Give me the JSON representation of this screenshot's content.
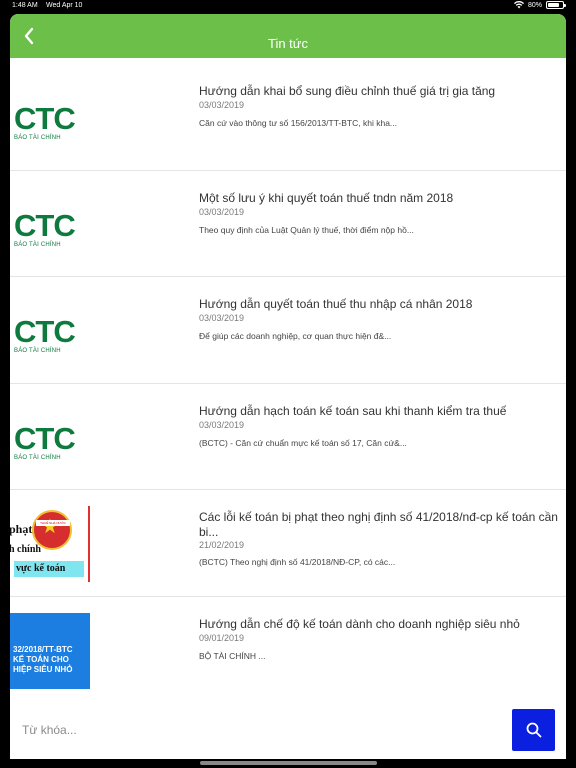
{
  "status_bar": {
    "time": "1:48 AM",
    "date": "Wed Apr 10",
    "battery": "80%",
    "battery_level": 0.8
  },
  "header": {
    "title": "Tin tức"
  },
  "articles": [
    {
      "title": "Hướng dẫn khai bổ sung điều chỉnh thuế giá trị gia tăng",
      "date": "03/03/2019",
      "excerpt": "Căn cứ vào thông tư số 156/2013/TT-BTC, khi kha...",
      "thumb_text": "CTC",
      "thumb_sub": "BÁO TÀI CHÍNH"
    },
    {
      "title": "Một số lưu ý khi quyết toán thuế tndn năm 2018",
      "date": "03/03/2019",
      "excerpt": "Theo quy định của Luật Quản lý thuế, thời điểm nộp hồ...",
      "thumb_text": "CTC",
      "thumb_sub": "BÁO TÀI CHÍNH"
    },
    {
      "title": "Hướng dẫn quyết toán thuế thu nhập cá nhân 2018",
      "date": "03/03/2019",
      "excerpt": "Để giúp các doanh nghiệp, cơ quan thực hiện đ&...",
      "thumb_text": "CTC",
      "thumb_sub": "BÁO TÀI CHÍNH"
    },
    {
      "title": "Hướng dẫn hạch toán kế toán sau khi thanh kiểm tra thuế",
      "date": "03/03/2019",
      "excerpt": "(BCTC) - Căn cứ chuẩn mực kế toán số 17, Căn cứ&...",
      "thumb_text": "CTC",
      "thumb_sub": "BÁO TÀI CHÍNH"
    },
    {
      "title": "Các lỗi kế toán bị phạt theo nghị định số 41/2018/nđ-cp kế toán cần bi...",
      "date": "21/02/2019",
      "excerpt": "(BCTC) Theo nghị định số 41/2018/NĐ-CP, có các...",
      "thumb_lines": [
        "phạt",
        "h chính",
        "vực kế toán"
      ],
      "thumb_seal": "THUẾ NHÀ NƯỚC"
    },
    {
      "title": "Hướng dẫn chế độ kế toán dành cho doanh nghiệp siêu nhỏ",
      "date": "09/01/2019",
      "excerpt": "BỘ TÀI CHÍNH   ...",
      "thumb_lines": [
        "32/2018/TT-BTC",
        "KẾ TOÁN CHO",
        "HIỆP SIÊU NHỎ"
      ]
    }
  ],
  "search": {
    "placeholder": "Từ khóa...",
    "value": ""
  },
  "colors": {
    "nav": "#6cc04a",
    "search_button": "#0a1fe0",
    "ctc_green": "#0f7a3e"
  }
}
